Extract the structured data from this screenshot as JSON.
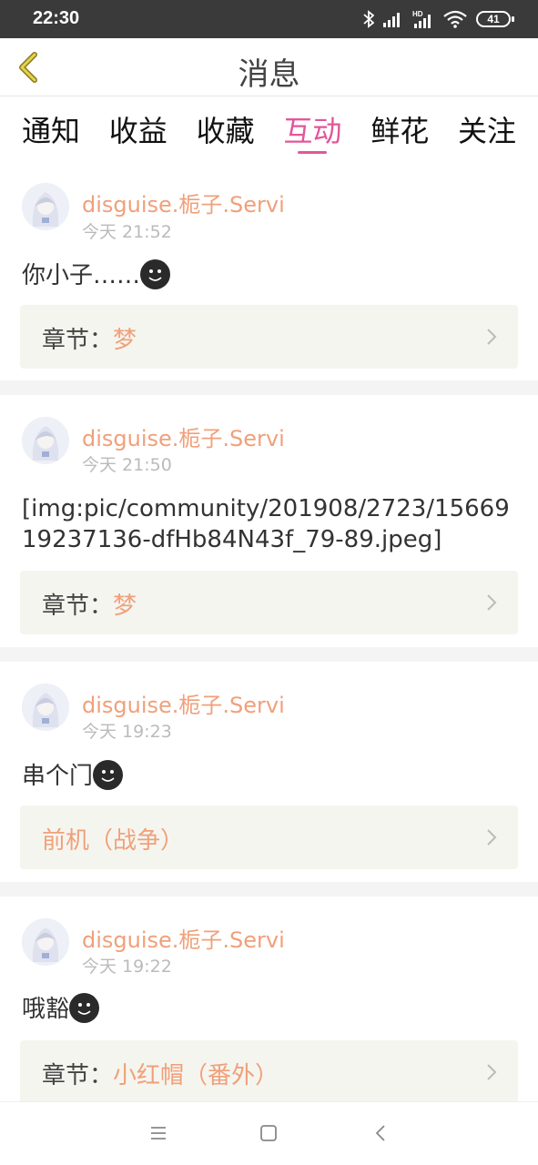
{
  "status_bar": {
    "time": "22:30",
    "battery": "41",
    "icons": [
      "bluetooth-icon",
      "signal-icon",
      "hd-signal-icon",
      "wifi-icon",
      "battery-icon"
    ]
  },
  "header": {
    "title": "消息",
    "back_icon": "chevron-left-icon"
  },
  "tabs": [
    {
      "label": "通知",
      "active": false
    },
    {
      "label": "收益",
      "active": false
    },
    {
      "label": "收藏",
      "active": false
    },
    {
      "label": "互动",
      "active": true
    },
    {
      "label": "鲜花",
      "active": false
    },
    {
      "label": "关注",
      "active": false
    }
  ],
  "colors": {
    "accent": "#e2579a",
    "username": "#f0a07a",
    "chapter_bg": "#f5f5ef"
  },
  "feed": [
    {
      "username": "disguise.栀子.Servi",
      "time": "今天 21:52",
      "content": "你小子……",
      "emoji": true,
      "chapter_prefix": "章节：",
      "chapter_value": "梦"
    },
    {
      "username": "disguise.栀子.Servi",
      "time": "今天 21:50",
      "content": "[img:pic/community/201908/2723/1566919237136-dfHb84N43f_79-89.jpeg]",
      "emoji": false,
      "chapter_prefix": "章节：",
      "chapter_value": "梦"
    },
    {
      "username": "disguise.栀子.Servi",
      "time": "今天 19:23",
      "content": "串个门",
      "emoji": true,
      "chapter_prefix": "",
      "chapter_value": "前机（战争）"
    },
    {
      "username": "disguise.栀子.Servi",
      "time": "今天 19:22",
      "content": "哦豁",
      "emoji": true,
      "chapter_prefix": "章节：",
      "chapter_value": "小红帽（番外）"
    }
  ],
  "navbar": {
    "icons": [
      "menu-icon",
      "home-square-icon",
      "back-triangle-icon"
    ]
  }
}
